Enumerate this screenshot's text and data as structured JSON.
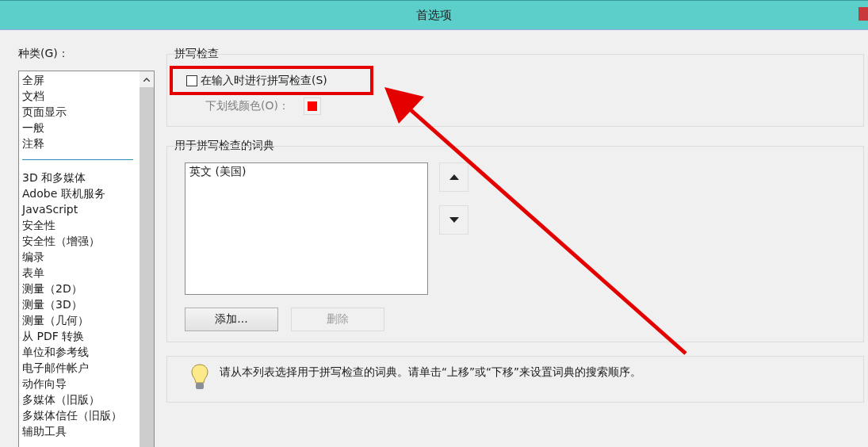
{
  "window": {
    "title": "首选项"
  },
  "categories": {
    "label": "种类(G)：",
    "items": [
      {
        "kind": "item",
        "label": "全屏"
      },
      {
        "kind": "item",
        "label": "文档"
      },
      {
        "kind": "item",
        "label": "页面显示"
      },
      {
        "kind": "item",
        "label": "一般"
      },
      {
        "kind": "item",
        "label": "注释"
      },
      {
        "kind": "separator"
      },
      {
        "kind": "item",
        "label": "3D 和多媒体"
      },
      {
        "kind": "item",
        "label": "Adobe 联机服务"
      },
      {
        "kind": "item",
        "label": "JavaScript"
      },
      {
        "kind": "item",
        "label": "安全性"
      },
      {
        "kind": "item",
        "label": "安全性（增强）"
      },
      {
        "kind": "item",
        "label": "编录"
      },
      {
        "kind": "item",
        "label": "表单"
      },
      {
        "kind": "item",
        "label": "测量（2D）"
      },
      {
        "kind": "item",
        "label": "测量（3D）"
      },
      {
        "kind": "item",
        "label": "测量（几何）"
      },
      {
        "kind": "item",
        "label": "从 PDF 转换"
      },
      {
        "kind": "item",
        "label": "单位和参考线"
      },
      {
        "kind": "item",
        "label": "电子邮件帐户"
      },
      {
        "kind": "item",
        "label": "动作向导"
      },
      {
        "kind": "item",
        "label": "多媒体（旧版）"
      },
      {
        "kind": "item",
        "label": "多媒体信任（旧版）"
      },
      {
        "kind": "item",
        "label": "辅助工具"
      }
    ]
  },
  "spelling": {
    "title": "拼写检查",
    "check_as_you_type": {
      "label": "在输入时进行拼写检查(S)",
      "checked": false
    },
    "underline_color": {
      "label": "下划线颜色(O)：",
      "color": "#ff0000",
      "disabled": true
    }
  },
  "dictionaries": {
    "title": "用于拼写检查的词典",
    "items": [
      "英文 (美国)"
    ],
    "buttons": [
      {
        "label": "添加...",
        "disabled": false
      },
      {
        "label": "删除",
        "disabled": true
      }
    ]
  },
  "tip": "请从本列表选择用于拼写检查的词典。请单击“上移”或“下移”来设置词典的搜索顺序。"
}
